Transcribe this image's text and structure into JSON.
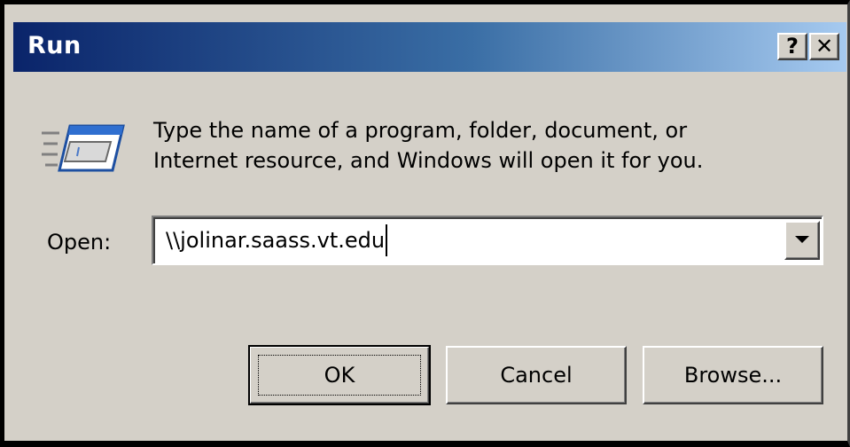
{
  "window": {
    "title": "Run",
    "help_label": "?",
    "close_label": "✕"
  },
  "icons": {
    "run": "run-dialog-icon",
    "dropdown": "chevron-down-icon"
  },
  "colors": {
    "titlebar_start": "#0a246a",
    "titlebar_end": "#a6caf0",
    "face": "#d4d0c8"
  },
  "prompt": {
    "line1": "Type the name of a program, folder, document, or",
    "line2": "Internet resource, and Windows will open it for you."
  },
  "open_field": {
    "label": "Open:",
    "value": "\\\\jolinar.saass.vt.edu"
  },
  "buttons": {
    "ok": "OK",
    "cancel": "Cancel",
    "browse": "Browse..."
  }
}
